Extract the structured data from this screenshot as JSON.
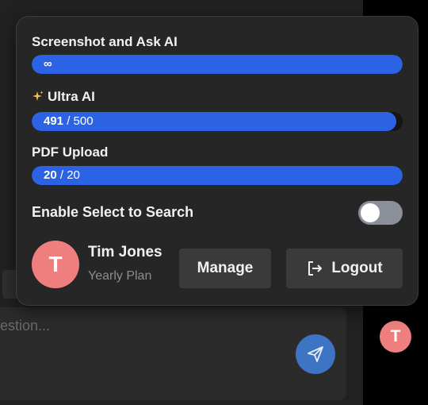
{
  "usage": {
    "screenshot": {
      "title": "Screenshot and Ask AI",
      "value_text": "∞",
      "fill": 1.0
    },
    "ultra": {
      "title": "Ultra AI",
      "used": "491",
      "sep_total": " / 500",
      "fill": 0.982
    },
    "pdf": {
      "title": "PDF Upload",
      "used": "20",
      "sep_total": " / 20",
      "fill": 1.0
    }
  },
  "select_search": {
    "label": "Enable Select to Search",
    "enabled": false
  },
  "user": {
    "initial": "T",
    "name": "Tim Jones",
    "plan": "Yearly Plan"
  },
  "buttons": {
    "manage": "Manage",
    "logout": "Logout"
  },
  "chat": {
    "placeholder": "estion..."
  },
  "side": {
    "avatar_initial": "T"
  },
  "colors": {
    "accent": "#2b63e4",
    "avatar": "#ef7f7f",
    "send": "#3d74c4"
  },
  "icons": {
    "sparkle": "sparkle-icon",
    "logout": "logout-icon",
    "send": "send-icon"
  }
}
